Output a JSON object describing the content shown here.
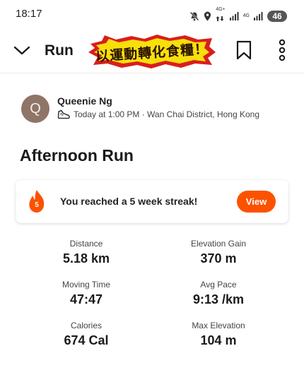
{
  "status_bar": {
    "time": "18:17",
    "network_4g_plus": "4G+",
    "network_4g": "4G",
    "battery": "46"
  },
  "header": {
    "title": "Run",
    "banner_text": "以運動轉化食糧！"
  },
  "athlete": {
    "initial": "Q",
    "name": "Queenie Ng",
    "meta": "Today at 1:00 PM · Wan Chai District, Hong Kong"
  },
  "activity": {
    "title": "Afternoon Run"
  },
  "streak": {
    "count": "5",
    "message": "You reached a 5 week streak!",
    "button_label": "View"
  },
  "stats": [
    {
      "label": "Distance",
      "value": "5.18 km"
    },
    {
      "label": "Elevation Gain",
      "value": "370 m"
    },
    {
      "label": "Moving Time",
      "value": "47:47"
    },
    {
      "label": "Avg Pace",
      "value": "9:13 /km"
    },
    {
      "label": "Calories",
      "value": "674 Cal"
    },
    {
      "label": "Max Elevation",
      "value": "104 m"
    }
  ],
  "colors": {
    "accent": "#fc5200",
    "banner_yellow": "#f8df0a",
    "banner_red": "#d91e1e",
    "avatar": "#8f7468"
  }
}
